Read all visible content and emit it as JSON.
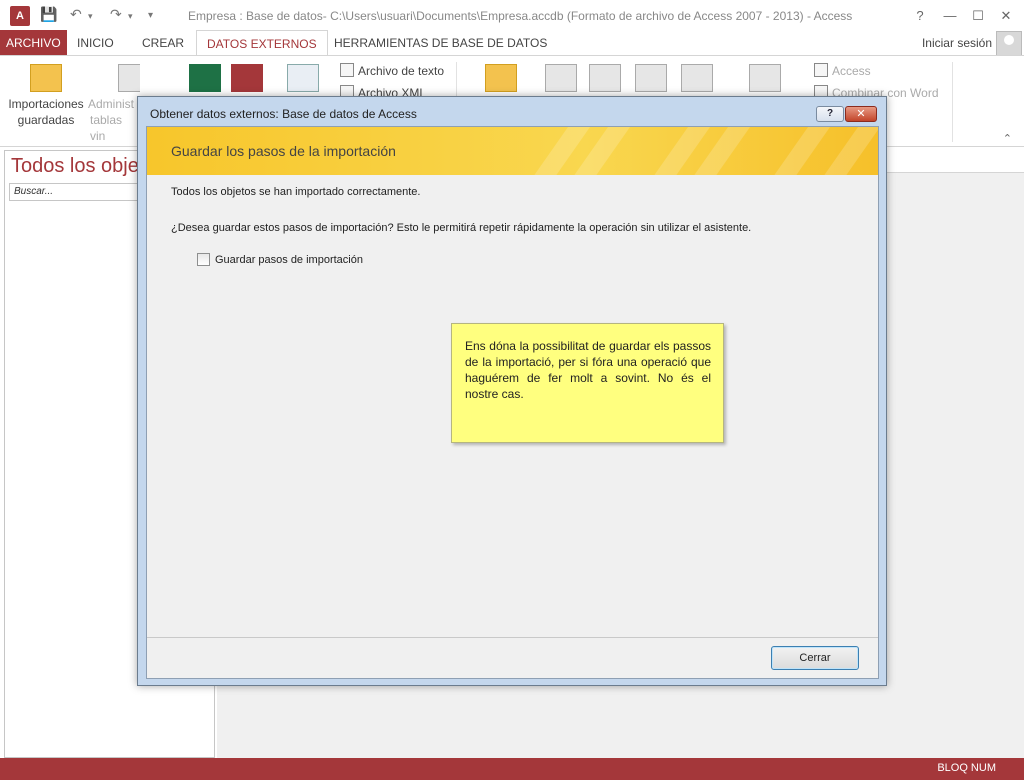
{
  "window": {
    "app_icon": "A",
    "title": "Empresa : Base de datos- C:\\Users\\usuari\\Documents\\Empresa.accdb (Formato de archivo de Access 2007 - 2013) - Access",
    "controls": [
      "?",
      "—",
      "☐",
      "✕"
    ]
  },
  "tabs": {
    "file": "ARCHIVO",
    "items": [
      "INICIO",
      "CREAR",
      "DATOS EXTERNOS",
      "HERRAMIENTAS DE BASE DE DATOS"
    ],
    "active": "DATOS EXTERNOS",
    "signin": "Iniciar sesión"
  },
  "ribbon": {
    "saved_imports": [
      "Importaciones",
      "guardadas"
    ],
    "linked_tables": [
      "Administ",
      "tablas vin"
    ],
    "text_file": "Archivo de texto",
    "xml_file": "Archivo XML",
    "access": "Access",
    "word_merge": "Combinar con Word"
  },
  "nav": {
    "title": "Todos los obje",
    "search_placeholder": "Buscar..."
  },
  "dialog": {
    "title": "Obtener datos externos: Base de datos de Access",
    "help": "?",
    "close": "✕",
    "banner_title": "Guardar los pasos de la importación",
    "success_message": "Todos los objetos se han importado correctamente.",
    "question": "¿Desea guardar estos pasos de importación? Esto le permitirá repetir rápidamente la operación sin utilizar el asistente.",
    "checkbox_label": "Guardar pasos de importación",
    "checkbox_checked": false,
    "close_button": "Cerrar"
  },
  "note": {
    "text": "Ens dóna la possibilitat de guardar els passos de la importació, per si fóra una operació que haguérem de fer molt a sovint. No és el nostre cas."
  },
  "status": {
    "numlock": "BLOQ NUM"
  },
  "colors": {
    "accent": "#a4373a",
    "banner": "#f7c62b",
    "note": "#ffff7f"
  }
}
